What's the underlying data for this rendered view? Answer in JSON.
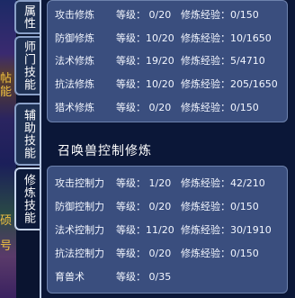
{
  "tabs": [
    {
      "label": "属性"
    },
    {
      "label": "师门技能"
    },
    {
      "label": "辅助技能"
    },
    {
      "label": "修炼技能",
      "active": true
    }
  ],
  "scene_text": [
    "帖",
    "能",
    "硕",
    "号"
  ],
  "character_cultivation": [
    {
      "name": "攻击修炼",
      "level": "等级： 0/20",
      "exp": "修炼经验：0/150"
    },
    {
      "name": "防御修炼",
      "level": "等级：10/20",
      "exp": "修炼经验：10/1650"
    },
    {
      "name": "法术修炼",
      "level": "等级：19/20",
      "exp": "修炼经验：5/4710"
    },
    {
      "name": "抗法修炼",
      "level": "等级：10/20",
      "exp": "修炼经验：205/1650"
    },
    {
      "name": "猎术修炼",
      "level": "等级： 0/20",
      "exp": "修炼经验：0/150"
    }
  ],
  "pet_section_title": "召唤兽控制修炼",
  "pet_cultivation": [
    {
      "name": "攻击控制力",
      "level": "等级： 1/20",
      "exp": "修炼经验：42/210"
    },
    {
      "name": "防御控制力",
      "level": "等级： 0/20",
      "exp": "修炼经验：0/150"
    },
    {
      "name": "法术控制力",
      "level": "等级：11/20",
      "exp": "修炼经验：30/1910"
    },
    {
      "name": "抗法控制力",
      "level": "等级： 0/20",
      "exp": "修炼经验：0/150"
    },
    {
      "name": "育兽术",
      "level": "等级： 0/35",
      "exp": ""
    }
  ]
}
